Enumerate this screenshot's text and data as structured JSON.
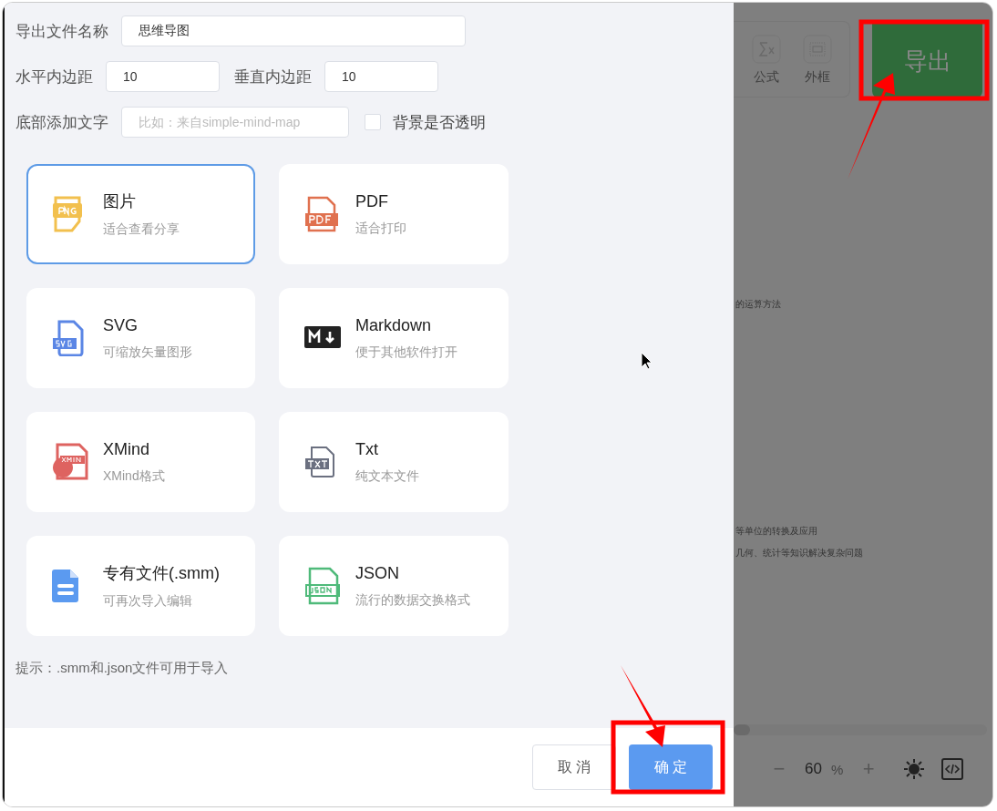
{
  "form": {
    "filename": {
      "label": "导出文件名称",
      "value": "思维导图"
    },
    "padding_x": {
      "label": "水平内边距",
      "value": "10"
    },
    "padding_y": {
      "label": "垂直内边距",
      "value": "10"
    },
    "footer_text": {
      "label": "底部添加文字",
      "placeholder": "比如：来自simple-mind-map"
    },
    "transparent": {
      "label": "背景是否透明",
      "checked": false
    }
  },
  "formats": [
    {
      "title": "图片",
      "desc": "适合查看分享",
      "kind": "png",
      "selected": true
    },
    {
      "title": "PDF",
      "desc": "适合打印",
      "kind": "pdf",
      "selected": false
    },
    {
      "title": "SVG",
      "desc": "可缩放矢量图形",
      "kind": "svg",
      "selected": false
    },
    {
      "title": "Markdown",
      "desc": "便于其他软件打开",
      "kind": "md",
      "selected": false
    },
    {
      "title": "XMind",
      "desc": "XMind格式",
      "kind": "xmind",
      "selected": false
    },
    {
      "title": "Txt",
      "desc": "纯文本文件",
      "kind": "txt",
      "selected": false
    },
    {
      "title": "专有文件(.smm)",
      "desc": "可再次导入编辑",
      "kind": "smm",
      "selected": false
    },
    {
      "title": "JSON",
      "desc": "流行的数据交换格式",
      "kind": "json",
      "selected": false
    }
  ],
  "hint": "提示：.smm和.json文件可用于导入",
  "footer": {
    "cancel": "取 消",
    "confirm": "确 定"
  },
  "background": {
    "toolbar": [
      {
        "label": "公式",
        "kind": "formula"
      },
      {
        "label": "外框",
        "kind": "frame"
      }
    ],
    "export_button": "导出",
    "mindmap_fragments": [
      "的运算方法",
      "等单位的转换及应用",
      "几何、统计等知识解决复杂问题"
    ],
    "zoom": {
      "minus": "−",
      "value": "60",
      "unit": "%",
      "plus": "+"
    }
  }
}
